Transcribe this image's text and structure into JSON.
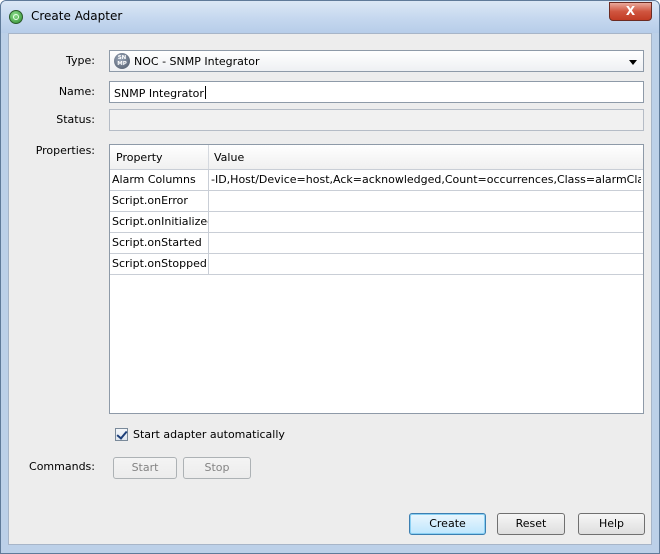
{
  "window": {
    "title": "Create Adapter",
    "close_glyph": "X"
  },
  "form": {
    "type_label": "Type:",
    "type_icon_text": "SN MP",
    "type_value": "NOC - SNMP Integrator",
    "name_label": "Name:",
    "name_value": "SNMP Integrator",
    "status_label": "Status:",
    "status_value": "",
    "properties_label": "Properties:"
  },
  "properties_table": {
    "headers": [
      "Property",
      "Value"
    ],
    "rows": [
      {
        "property": "Alarm Columns",
        "value": "-ID,Host/Device=host,Ack=acknowledged,Count=occurrences,Class=alarmClass,..."
      },
      {
        "property": "Script.onError",
        "value": ""
      },
      {
        "property": "Script.onInitialized",
        "value": ""
      },
      {
        "property": "Script.onStarted",
        "value": ""
      },
      {
        "property": "Script.onStopped",
        "value": ""
      }
    ]
  },
  "auto_start": {
    "label": "Start adapter automatically",
    "checked": true
  },
  "commands": {
    "label": "Commands:",
    "start_label": "Start",
    "stop_label": "Stop"
  },
  "footer": {
    "create_label": "Create",
    "reset_label": "Reset",
    "help_label": "Help"
  }
}
